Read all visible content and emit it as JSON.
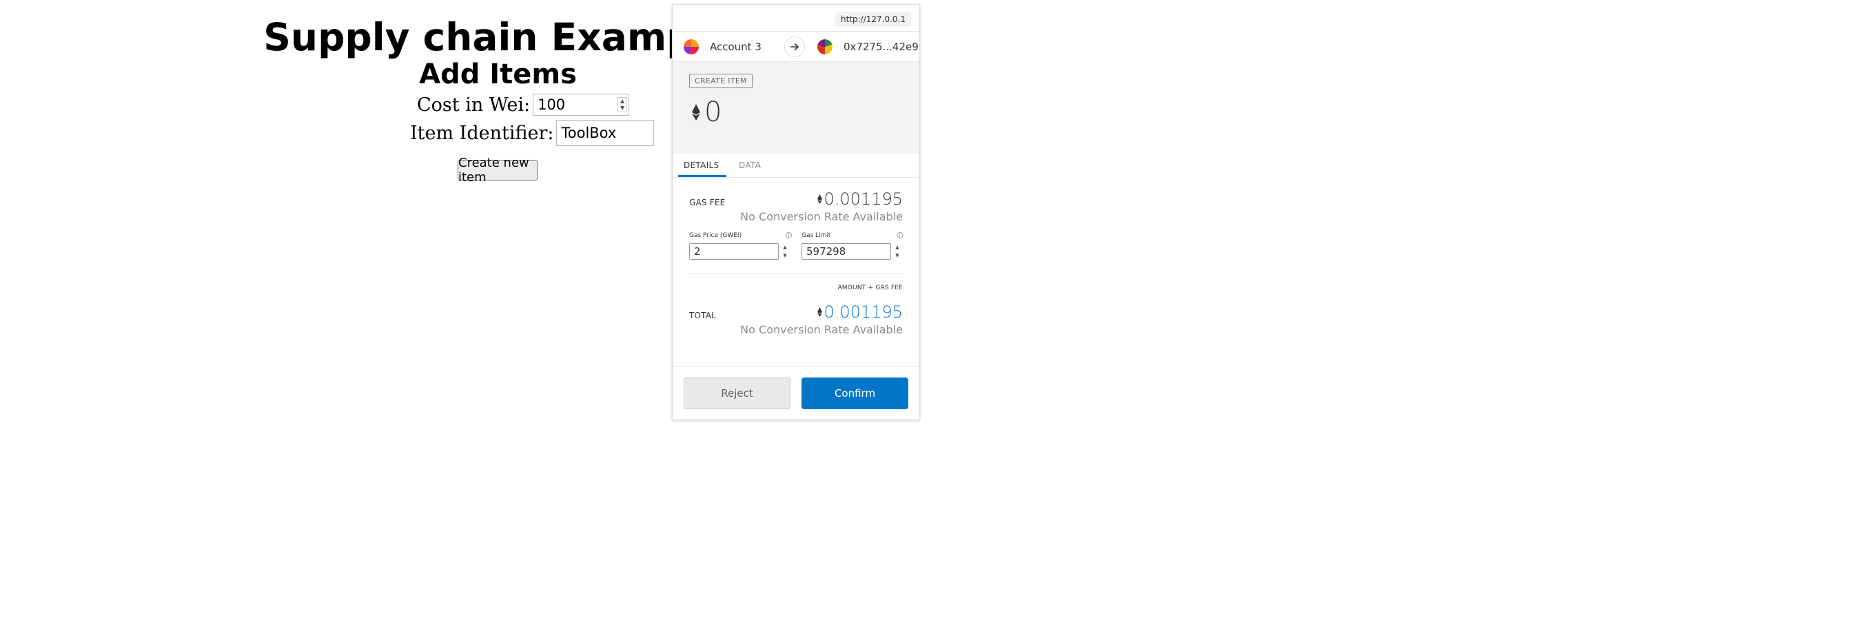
{
  "dapp": {
    "title": "Supply chain Example",
    "subtitle": "Add Items",
    "cost_label": "Cost in Wei:",
    "cost_value": "100",
    "identifier_label": "Item Identifier:",
    "identifier_value": "ToolBox",
    "create_button": "Create new item"
  },
  "metamask": {
    "origin": "http://127.0.0.1",
    "from_account": "Account 3",
    "to_account": "0x7275...42e9",
    "method": "CREATE ITEM",
    "amount": "0",
    "tabs": [
      "DETAILS",
      "DATA"
    ],
    "active_tab": "DETAILS",
    "gas_fee": {
      "label": "GAS FEE",
      "value": "0.001195",
      "conversion": "No Conversion Rate Available"
    },
    "gas_price": {
      "label": "Gas Price (GWEI)",
      "value": "2"
    },
    "gas_limit": {
      "label": "Gas Limit",
      "value": "597298"
    },
    "total_hint": "AMOUNT + GAS FEE",
    "total": {
      "label": "TOTAL",
      "value": "0.001195",
      "conversion": "No Conversion Rate Available"
    },
    "reject_button": "Reject",
    "confirm_button": "Confirm",
    "colors": {
      "accent": "#0376c9",
      "summary_bg": "#f3f3f3"
    }
  }
}
